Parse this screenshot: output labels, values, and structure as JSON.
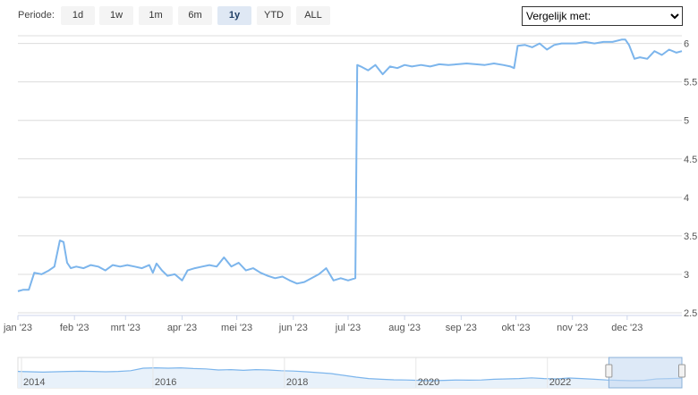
{
  "toolbar": {
    "periode_label": "Periode:",
    "ranges": [
      "1d",
      "1w",
      "1m",
      "6m",
      "1y",
      "YTD",
      "ALL"
    ],
    "active_range": "1y",
    "compare_placeholder": "Vergelijk met:"
  },
  "colors": {
    "line": "#7cb5ec",
    "grid": "#dcdcdc",
    "nav_fill": "#e8f1fa",
    "nav_selection": "#c6dbf2"
  },
  "chart_data": {
    "type": "line",
    "title": "",
    "xlabel": "",
    "ylabel": "",
    "ylim": [
      2.5,
      6.1
    ],
    "yticks": [
      2.5,
      3,
      3.5,
      4,
      4.5,
      5,
      5.5,
      6
    ],
    "ytick_labels": [
      "2.5",
      "3",
      "3.5",
      "4",
      "4.5",
      "5",
      "5.5",
      "6"
    ],
    "grid": true,
    "x_labels": [
      "jan '23",
      "feb '23",
      "mrt '23",
      "apr '23",
      "mei '23",
      "jun '23",
      "jul '23",
      "aug '23",
      "sep '23",
      "okt '23",
      "nov '23",
      "dec '23"
    ],
    "series": [
      {
        "x": [
          "2023-01-01",
          "2023-01-04",
          "2023-01-07",
          "2023-01-10",
          "2023-01-14",
          "2023-01-18",
          "2023-01-21",
          "2023-01-24",
          "2023-01-26",
          "2023-01-28",
          "2023-01-30",
          "2023-02-02",
          "2023-02-06",
          "2023-02-10",
          "2023-02-14",
          "2023-02-18",
          "2023-02-22",
          "2023-02-26",
          "2023-03-02",
          "2023-03-06",
          "2023-03-10",
          "2023-03-14",
          "2023-03-16",
          "2023-03-18",
          "2023-03-21",
          "2023-03-24",
          "2023-03-28",
          "2023-04-01",
          "2023-04-04",
          "2023-04-08",
          "2023-04-12",
          "2023-04-16",
          "2023-04-20",
          "2023-04-24",
          "2023-04-28",
          "2023-05-02",
          "2023-05-06",
          "2023-05-10",
          "2023-05-14",
          "2023-05-18",
          "2023-05-22",
          "2023-05-26",
          "2023-05-30",
          "2023-06-03",
          "2023-06-07",
          "2023-06-11",
          "2023-06-15",
          "2023-06-19",
          "2023-06-23",
          "2023-06-27",
          "2023-07-01",
          "2023-07-05",
          "2023-07-06",
          "2023-07-08",
          "2023-07-12",
          "2023-07-16",
          "2023-07-20",
          "2023-07-24",
          "2023-07-28",
          "2023-08-01",
          "2023-08-05",
          "2023-08-10",
          "2023-08-15",
          "2023-08-20",
          "2023-08-25",
          "2023-08-30",
          "2023-09-04",
          "2023-09-09",
          "2023-09-14",
          "2023-09-19",
          "2023-09-24",
          "2023-09-28",
          "2023-09-30",
          "2023-10-02",
          "2023-10-06",
          "2023-10-10",
          "2023-10-14",
          "2023-10-18",
          "2023-10-22",
          "2023-10-26",
          "2023-10-30",
          "2023-11-03",
          "2023-11-08",
          "2023-11-13",
          "2023-11-18",
          "2023-11-23",
          "2023-11-28",
          "2023-11-30",
          "2023-12-02",
          "2023-12-05",
          "2023-12-08",
          "2023-12-12",
          "2023-12-16",
          "2023-12-20",
          "2023-12-24",
          "2023-12-28",
          "2023-12-31"
        ],
        "y": [
          2.78,
          2.8,
          2.8,
          3.02,
          3.0,
          3.05,
          3.1,
          3.44,
          3.42,
          3.15,
          3.08,
          3.1,
          3.08,
          3.12,
          3.1,
          3.05,
          3.12,
          3.1,
          3.12,
          3.1,
          3.08,
          3.12,
          3.02,
          3.14,
          3.05,
          2.98,
          3.0,
          2.92,
          3.05,
          3.08,
          3.1,
          3.12,
          3.1,
          3.22,
          3.1,
          3.15,
          3.05,
          3.08,
          3.02,
          2.98,
          2.95,
          2.97,
          2.92,
          2.88,
          2.9,
          2.95,
          3.0,
          3.08,
          2.92,
          2.95,
          2.92,
          2.95,
          5.72,
          5.7,
          5.65,
          5.72,
          5.6,
          5.7,
          5.68,
          5.72,
          5.7,
          5.72,
          5.7,
          5.73,
          5.72,
          5.73,
          5.74,
          5.73,
          5.72,
          5.74,
          5.72,
          5.7,
          5.68,
          5.97,
          5.98,
          5.95,
          6.0,
          5.92,
          5.98,
          6.0,
          6.0,
          6.0,
          6.02,
          6.0,
          6.02,
          6.02,
          6.05,
          6.05,
          5.98,
          5.8,
          5.82,
          5.8,
          5.9,
          5.85,
          5.92,
          5.88,
          5.9
        ]
      }
    ],
    "navigator": {
      "x_labels": [
        "2014",
        "2016",
        "2018",
        "2020",
        "2022"
      ],
      "values": [
        0.62,
        0.6,
        0.58,
        0.6,
        0.62,
        0.63,
        0.62,
        0.6,
        0.62,
        0.66,
        0.8,
        0.82,
        0.8,
        0.82,
        0.78,
        0.76,
        0.7,
        0.72,
        0.68,
        0.72,
        0.7,
        0.66,
        0.64,
        0.6,
        0.55,
        0.5,
        0.4,
        0.3,
        0.22,
        0.18,
        0.15,
        0.14,
        0.12,
        0.1,
        0.12,
        0.14,
        0.13,
        0.14,
        0.18,
        0.2,
        0.22,
        0.26,
        0.22,
        0.2,
        0.25,
        0.22,
        0.18,
        0.14,
        0.12,
        0.1,
        0.12,
        0.2,
        0.22,
        0.24
      ],
      "selection_start": 0.89,
      "selection_end": 1.0
    }
  }
}
